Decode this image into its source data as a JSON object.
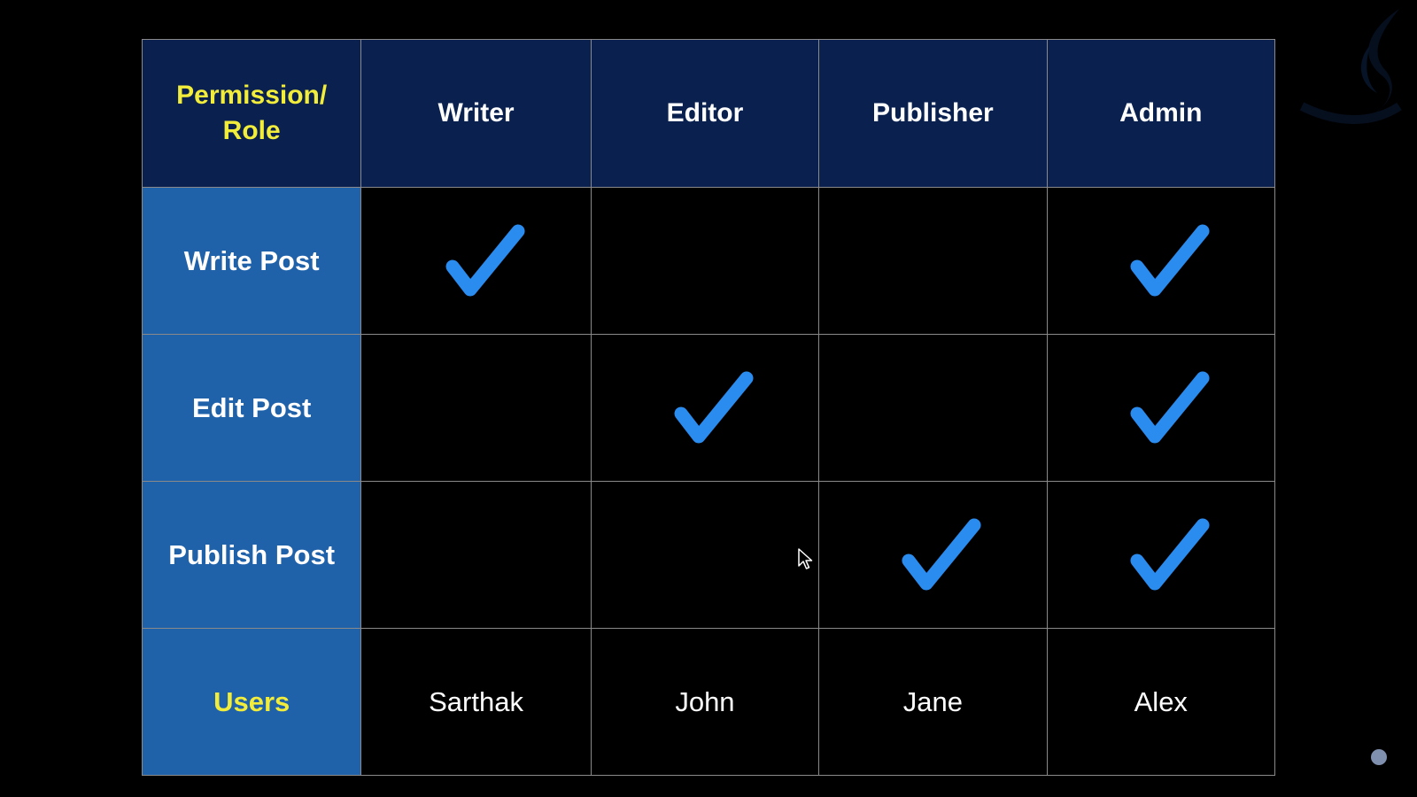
{
  "table": {
    "corner_line1": "Permission/",
    "corner_line2": "Role",
    "roles": [
      "Writer",
      "Editor",
      "Publisher",
      "Admin"
    ],
    "permissions": [
      {
        "label": "Write Post",
        "granted": [
          true,
          false,
          false,
          true
        ]
      },
      {
        "label": "Edit Post",
        "granted": [
          false,
          true,
          false,
          true
        ]
      },
      {
        "label": "Publish Post",
        "granted": [
          false,
          false,
          true,
          true
        ]
      }
    ],
    "users_label": "Users",
    "users": [
      "Sarthak",
      "John",
      "Jane",
      "Alex"
    ]
  },
  "icons": {
    "check": "check-mark-icon",
    "cursor": "mouse-pointer-icon",
    "logo": "flame-logo-icon"
  },
  "colors": {
    "header_bg": "#0a2150",
    "label_bg": "#2062aa",
    "accent_yellow": "#f2ec3a",
    "check_blue": "#2b8cf0",
    "grid_line": "#8a8a8a",
    "background": "#000000"
  }
}
